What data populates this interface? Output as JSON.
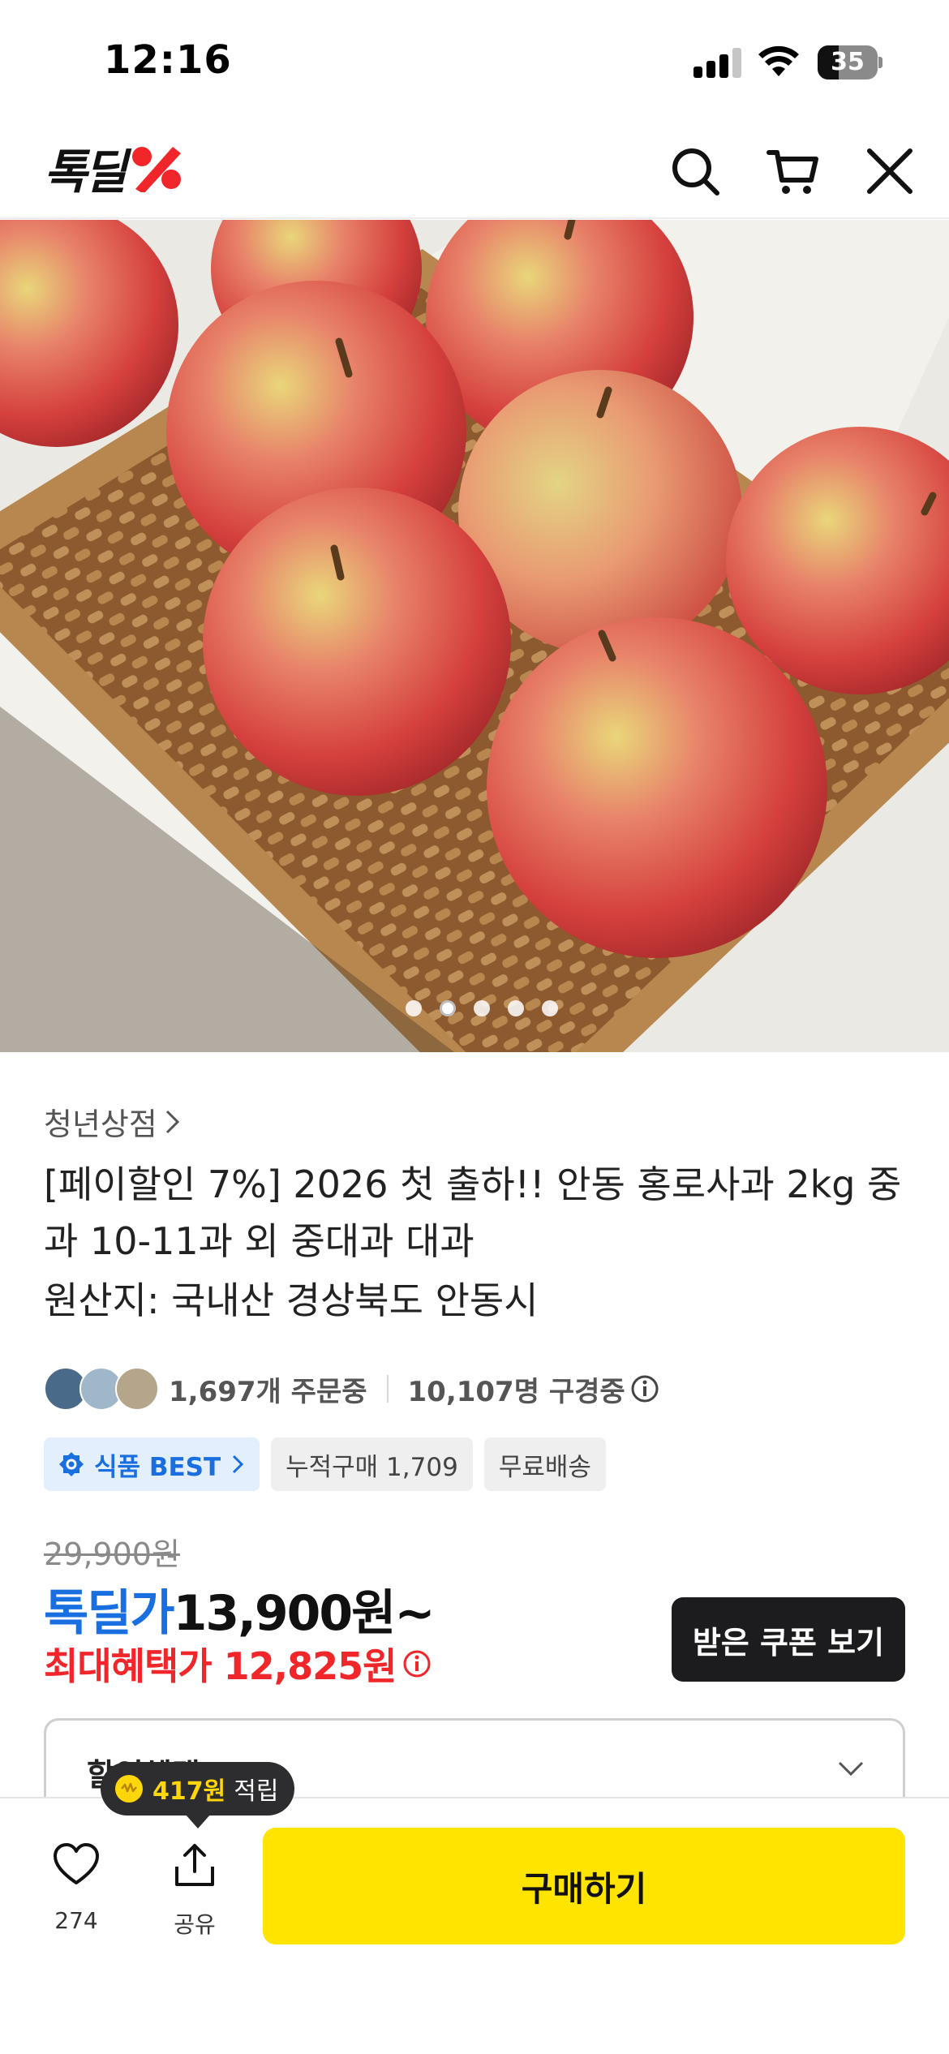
{
  "status_bar": {
    "time": "12:16",
    "battery": "35",
    "battery_level": 0.35
  },
  "header": {
    "logo_text": "톡딜",
    "icons": [
      "search-icon",
      "cart-icon",
      "close-icon"
    ]
  },
  "gallery": {
    "image_count": 5,
    "active_index": 1
  },
  "product": {
    "store": "청년상점",
    "title": "[페이할인 7%] 2026 첫 출하!! 안동 홍로사과 2kg 중과 10-11과 외 중대과 대과",
    "origin": "원산지: 국내산 경상북도 안동시",
    "orders": "1,697개 주문중",
    "viewers": "10,107명 구경중",
    "badges": {
      "best": "식품 BEST",
      "cumulative": "누적구매 1,709",
      "shipping": "무료배송"
    },
    "original_price": "29,900원",
    "deal_label": "톡딜가",
    "deal_price": "13,900원~",
    "max_benefit": "최대혜택가 12,825원",
    "coupon_button": "받은 쿠폰 보기",
    "discount_section": "할인혜택"
  },
  "bottom_bar": {
    "like_count": "274",
    "share_label": "공유",
    "buy_button": "구매하기",
    "reward_amount": "417원",
    "reward_suffix": "적립"
  },
  "colors": {
    "brand_red": "#f0262a",
    "deal_blue": "#1a6fe0",
    "buy_yellow": "#ffe400"
  }
}
